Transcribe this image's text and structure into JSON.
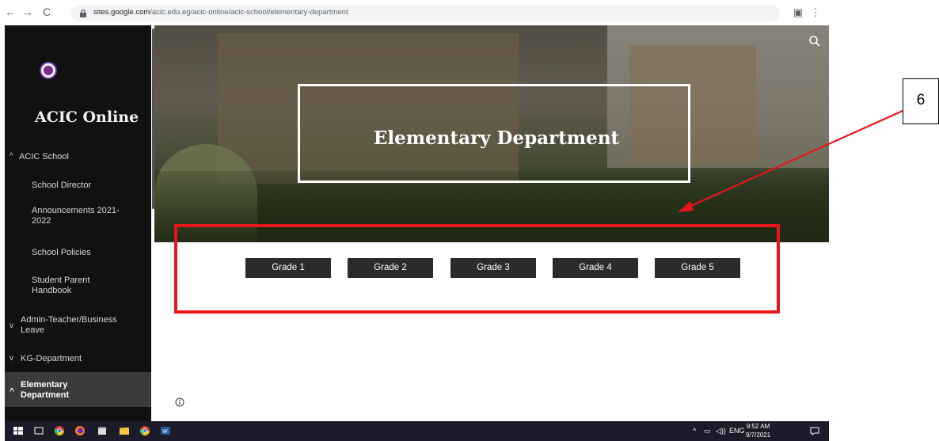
{
  "browser": {
    "url_domain": "sites.google.com",
    "url_path": "/acic.edu.eg/acic-online/acic-school/elementary-department"
  },
  "sidebar": {
    "site_title": "ACIC Online",
    "items": [
      {
        "label": "ACIC School",
        "chevron": "^"
      },
      {
        "label": "School Director"
      },
      {
        "label": "Announcements 2021-2022"
      },
      {
        "label": "School Policies"
      },
      {
        "label": "Student Parent Handbook"
      },
      {
        "label": "Admin-Teacher/Business Leave",
        "chevron": "v"
      },
      {
        "label": "KG-Department",
        "chevron": "v"
      },
      {
        "label": "Elementary Department",
        "chevron": "^"
      }
    ]
  },
  "hero": {
    "title": "Elementary Department"
  },
  "grades": [
    "Grade 1",
    "Grade 2",
    "Grade 3",
    "Grade 4",
    "Grade 5"
  ],
  "annotation": {
    "callout_number": "6",
    "highlight_color": "#e8141c"
  },
  "taskbar": {
    "language": "ENG",
    "time": "9:52 AM",
    "date": "9/7/2021"
  }
}
